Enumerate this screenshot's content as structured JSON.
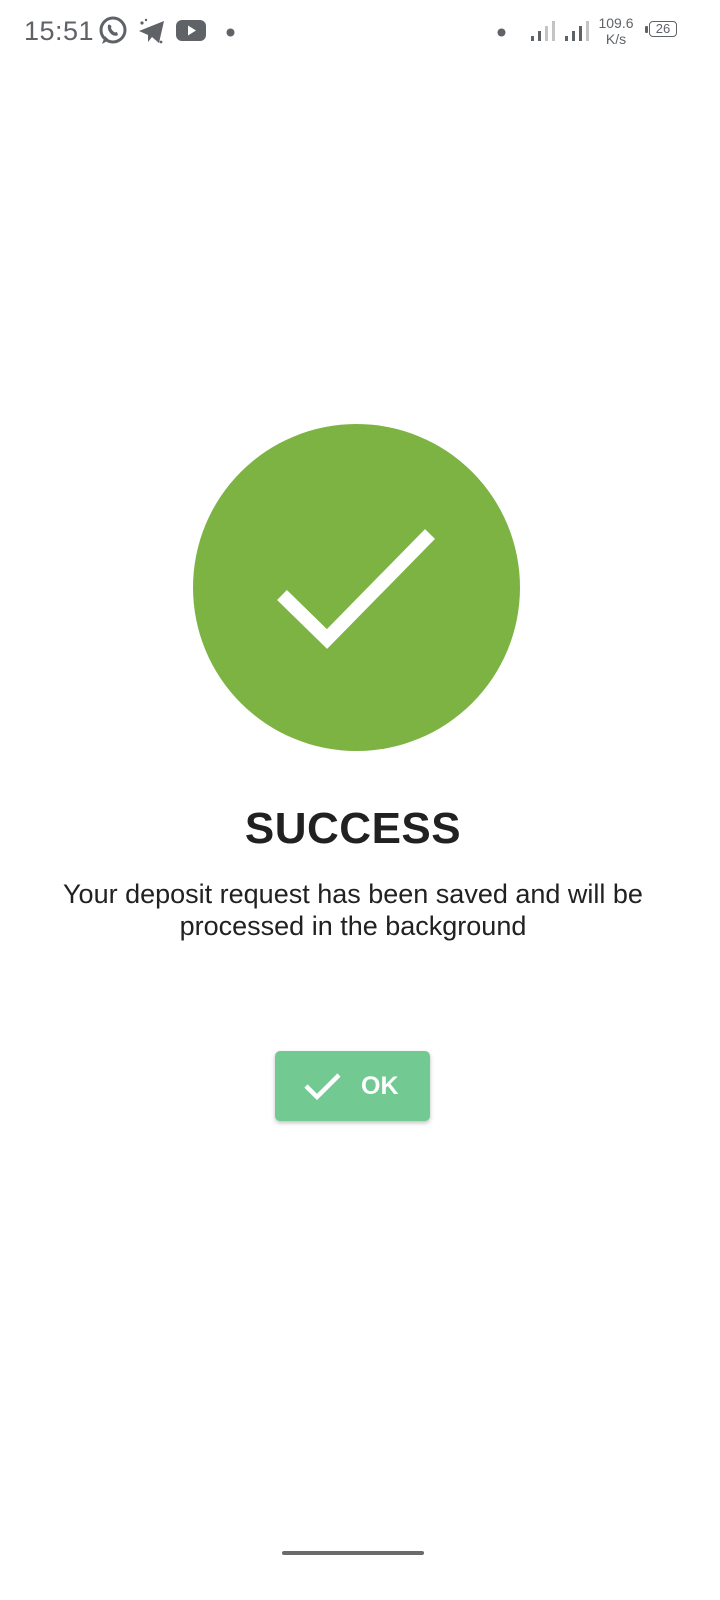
{
  "status_bar": {
    "time": "15:51",
    "net_speed_value": "109.6",
    "net_speed_unit": "K/s",
    "battery_level": "26",
    "icons": [
      "whatsapp-icon",
      "telegram-icon",
      "youtube-icon",
      "notification-dot-icon",
      "signal-icon",
      "signal-icon",
      "battery-icon"
    ]
  },
  "dialog": {
    "title": "SUCCESS",
    "message": "Your deposit request has been saved and will be processed in the background",
    "ok_label": "OK",
    "icon": "check-circle-icon"
  },
  "colors": {
    "success_green": "#7cb342",
    "button_green": "#72c991",
    "text": "#212121",
    "status_icons": "#5f6368"
  }
}
